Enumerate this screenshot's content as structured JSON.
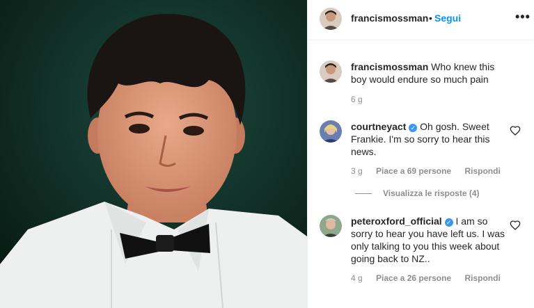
{
  "post": {
    "author": "francismossman",
    "follow_label": "Segui",
    "separator": "•",
    "more_icon": "•••"
  },
  "comments": [
    {
      "username": "francismossman",
      "text": "Who knew this boy would endure so much pain",
      "time": "6 g",
      "verified": false
    },
    {
      "username": "courtneyact",
      "text": "Oh gosh. Sweet Frankie. I'm so sorry to hear this news.",
      "time": "3 g",
      "likes": "Piace a 69 persone",
      "reply_label": "Rispondi",
      "verified": true,
      "view_replies": "Visualizza le risposte (4)"
    },
    {
      "username": "peteroxford_official",
      "text": "I am so sorry to hear you have left us. I was only talking to you this week about going back to NZ..",
      "time": "4 g",
      "likes": "Piace a 26 persone",
      "reply_label": "Rispondi",
      "verified": true
    }
  ],
  "colors": {
    "follow_blue": "#0095f6",
    "verified_blue": "#3897f0",
    "muted_text": "#8e8e8e",
    "photo_background": "#0c2a24"
  },
  "icons": [
    "more-options-icon",
    "verified-icon",
    "heart-icon"
  ]
}
